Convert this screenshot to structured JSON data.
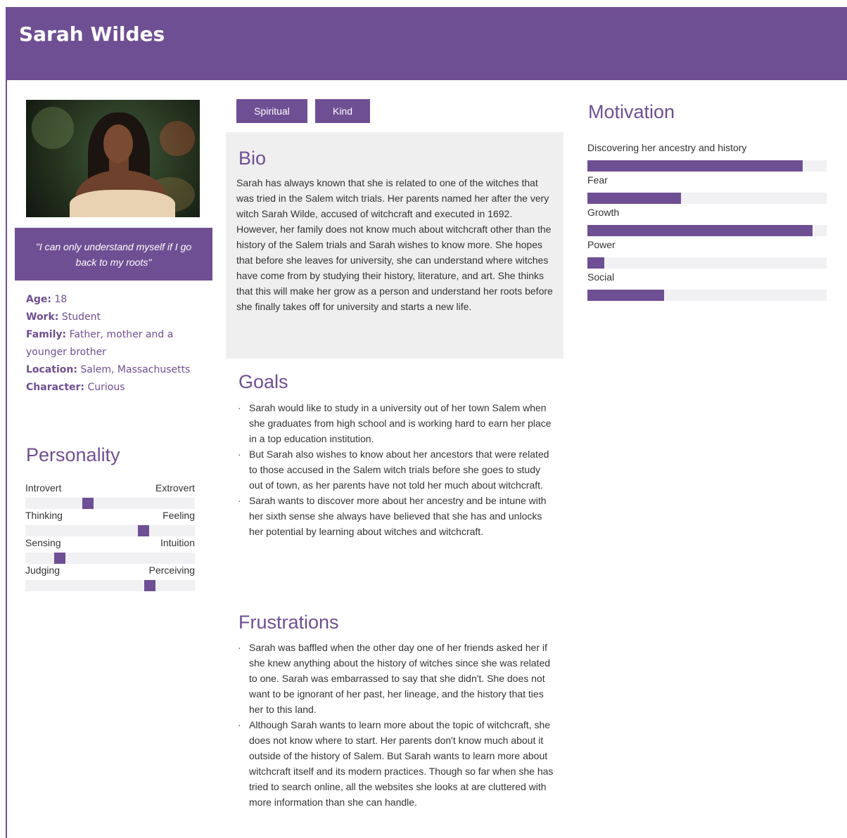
{
  "persona": {
    "name": "Sarah Wildes",
    "quote": "\"I can only understand myself if I go back to my roots\"",
    "facts": [
      {
        "label": "Age:",
        "value": "18"
      },
      {
        "label": "Work:",
        "value": "Student"
      },
      {
        "label": "Family:",
        "value": "Father, mother and a younger brother"
      },
      {
        "label": "Location:",
        "value": "Salem, Massachusetts"
      },
      {
        "label": "Character:",
        "value": "Curious"
      }
    ]
  },
  "tags": [
    "Spiritual",
    "Kind"
  ],
  "personality": {
    "title": "Personality",
    "traits": [
      {
        "left": "Introvert",
        "right": "Extrovert",
        "value": 0.36
      },
      {
        "left": "Thinking",
        "right": "Feeling",
        "value": 0.71
      },
      {
        "left": "Sensing",
        "right": "Intuition",
        "value": 0.18
      },
      {
        "left": "Judging",
        "right": "Perceiving",
        "value": 0.75
      }
    ]
  },
  "bio": {
    "title": "Bio",
    "text": "Sarah has always known that she is related to one of the witches that was tried in the Salem witch trials. Her parents named her after the very witch Sarah Wilde, accused of witchcraft and executed in 1692. However, her family does not know much about witchcraft other than the history of the Salem trials and Sarah wishes to know more. She hopes that before she leaves for university, she can understand where witches have come from by studying their history, literature, and art. She thinks that this will make her grow as a person and understand her roots before she finally takes off for university and starts a new life."
  },
  "goals": {
    "title": "Goals",
    "items": [
      "Sarah would like to study in a university out of her town Salem when she graduates from high school and is working hard to earn her place in a top education institution.",
      "But Sarah also wishes to know about her ancestors that were related to those accused in the Salem witch trials before she goes to study out of town, as her parents have not told her much about witchcraft.",
      "Sarah wants to discover more about her ancestry and be intune with her sixth sense she always have believed that she has and unlocks her potential by learning about witches and witchcraft."
    ]
  },
  "frustrations": {
    "title": "Frustrations",
    "items": [
      "Sarah was baffled when the other day one of her friends asked her if she knew anything about the history of witches since she was related to one. Sarah was embarrassed to say that she didn't. She does not want to be ignorant of her past, her lineage, and the history that ties her to this land.",
      "Although Sarah wants to learn more about the topic of witchcraft, she does not know where to start. Her parents don't know much about it outside of the history of Salem. But Sarah wants to learn more about witchcraft itself and its modern practices.  Though so far when she has tried to search online, all the websites she looks at are cluttered with more information than she can handle."
    ]
  },
  "motivation": {
    "title": "Motivation",
    "items": [
      {
        "label": "Discovering her ancestry and history",
        "value": 0.9
      },
      {
        "label": "Fear",
        "value": 0.39
      },
      {
        "label": "Growth",
        "value": 0.94
      },
      {
        "label": "Power",
        "value": 0.07
      },
      {
        "label": "Social",
        "value": 0.32
      }
    ]
  },
  "colors": {
    "accent": "#6f4f93",
    "track": "#f1f1f3",
    "panel": "#efefef"
  }
}
